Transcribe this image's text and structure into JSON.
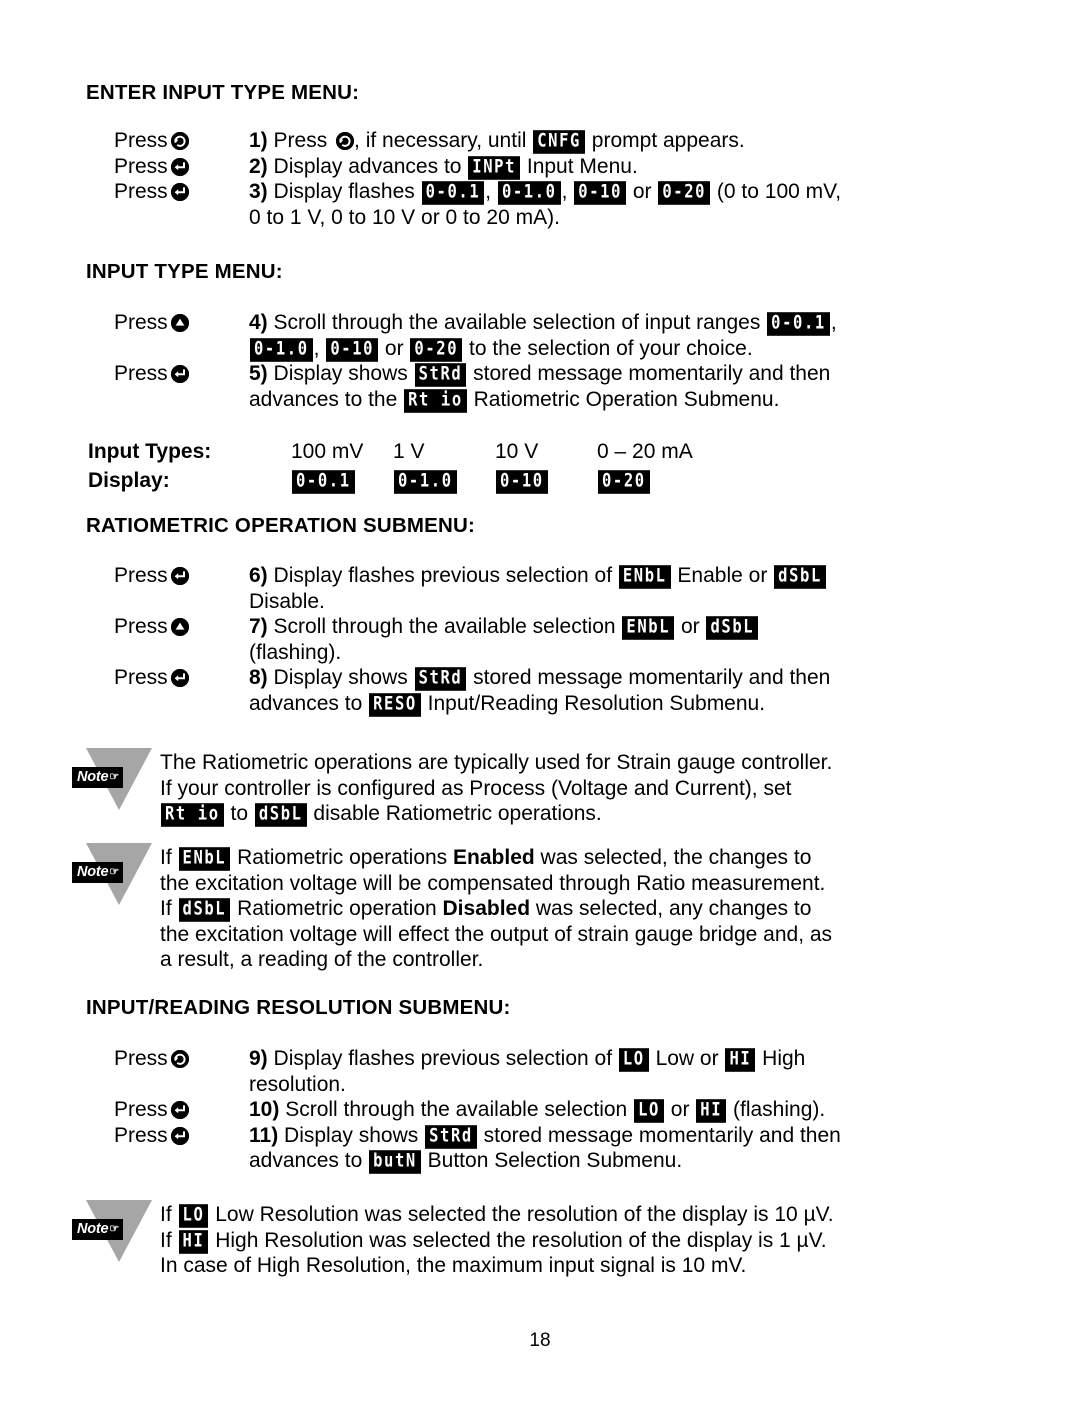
{
  "page": {
    "number": "18"
  },
  "sections": {
    "enter_input_type": {
      "heading": "ENTER INPUT TYPE MENU:",
      "press_label": "Press",
      "steps": [
        {
          "press_icon": "loop-arrow-icon",
          "number": "1)",
          "text_before": " Press ",
          "text_mid": ", if necessary, until ",
          "led": "CNFG",
          "text_after": " prompt appears."
        },
        {
          "press_icon": "enter-arrow-icon",
          "number": "2)",
          "text_before": " Display advances to ",
          "led": "INPt",
          "text_after": " Input Menu."
        },
        {
          "press_icon": "enter-arrow-icon",
          "number": "3)",
          "text_before": " Display flashes ",
          "led1": "0-0.1",
          "sep1": ", ",
          "led2": "0-1.0",
          "sep2": ", ",
          "led3": "0-10",
          "sep3": " or ",
          "led4": "0-20",
          "text_after": " (0 to 100 mV,",
          "line2": "0 to 1 V, 0 to 10 V or 0 to 20 mA)."
        }
      ]
    },
    "input_type": {
      "heading": "INPUT TYPE MENU:",
      "press_label": "Press",
      "steps": [
        {
          "press_icon": "up-triangle-icon",
          "number": "4)",
          "text_before": " Scroll through the available selection of input ranges ",
          "led1": "0-0.1",
          "sep1": ",",
          "led2": "0-1.0",
          "sep2": ", ",
          "led3": "0-10",
          "sep3": " or ",
          "led4": "0-20",
          "text_after": " to the selection of your choice."
        },
        {
          "press_icon": "enter-arrow-icon",
          "number": "5)",
          "text_before": " Display shows ",
          "led": "StRd",
          "text_mid": " stored message momentarily and then",
          "line2_before": "advances to the ",
          "led2": "Rt io",
          "line2_after": " Ratiometric Operation Submenu."
        }
      ]
    },
    "input_types_table": {
      "row_labels": [
        "Input Types:",
        "Display:"
      ],
      "types": [
        "100 mV",
        "1 V",
        "10 V",
        "0 – 20 mA"
      ],
      "displays": [
        "0-0.1",
        "0-1.0",
        "0-10",
        "0-20"
      ]
    },
    "ratiometric": {
      "heading": "RATIOMETRIC OPERATION SUBMENU:",
      "press_label": "Press",
      "steps": [
        {
          "press_icon": "enter-arrow-icon",
          "number": "6)",
          "text_before": " Display flashes previous selection of ",
          "led1": "ENbL",
          "text_mid": " Enable or ",
          "led2": "dSbL",
          "line2": "Disable."
        },
        {
          "press_icon": "up-triangle-icon",
          "number": "7)",
          "text_before": " Scroll through the available selection ",
          "led1": "ENbL",
          "text_mid": " or ",
          "led2": "dSbL",
          "line2": "(flashing)."
        },
        {
          "press_icon": "enter-arrow-icon",
          "number": "8)",
          "text_before": " Display shows ",
          "led": "StRd",
          "text_mid": " stored message momentarily and then",
          "line2_before": "advances to ",
          "led2": "RESO",
          "line2_after": " Input/Reading Resolution Submenu."
        }
      ]
    },
    "note_ratiometric": {
      "tag": "Note",
      "hand": "☞",
      "line1": "The Ratiometric operations are typically used for Strain gauge controller.",
      "line2": "If your controller is configured as Process (Voltage and Current), set",
      "line3_led1": "Rt io",
      "line3_mid": " to ",
      "line3_led2": "dSbL",
      "line3_after": " disable Ratiometric operations."
    },
    "note_enable_disable": {
      "tag": "Note",
      "hand": "☞",
      "l1_before": "If ",
      "l1_led": "ENbL",
      "l1_mid": " Ratiometric operations ",
      "l1_bold": "Enabled",
      "l1_after": " was selected, the changes to",
      "l2": "the excitation voltage will be compensated through Ratio measurement.",
      "l3_before": "If ",
      "l3_led": "dSbL",
      "l3_mid": " Ratiometric operation ",
      "l3_bold": "Disabled",
      "l3_after": " was selected, any changes to",
      "l4": "the excitation voltage will effect the output of strain gauge bridge and, as",
      "l5": "a result, a reading of the controller."
    },
    "resolution": {
      "heading": "INPUT/READING RESOLUTION SUBMENU:",
      "press_label": "Press",
      "steps": [
        {
          "press_icon": "loop-arrow-icon",
          "number": "9)",
          "text_before": " Display flashes previous selection of ",
          "led1": "LO",
          "text_mid": " Low or ",
          "led2": "HI",
          "text_after": " High",
          "line2": "resolution."
        },
        {
          "press_icon": "enter-arrow-icon",
          "number": "10)",
          "text_before": " Scroll through the available selection ",
          "led1": "LO",
          "text_mid": " or ",
          "led2": "HI",
          "text_after": " (flashing)."
        },
        {
          "press_icon": "enter-arrow-icon",
          "number": "11)",
          "text_before": " Display shows ",
          "led": "StRd",
          "text_mid": " stored message momentarily and then",
          "line2_before": "advances to ",
          "led2": "butN",
          "line2_after": " Button Selection Submenu."
        }
      ]
    },
    "note_resolution": {
      "tag": "Note",
      "hand": "☞",
      "l1_before": "If ",
      "l1_led": "LO",
      "l1_after": " Low Resolution was selected the resolution of the display is 10 µV.",
      "l2_before": "If ",
      "l2_led": "HI",
      "l2_after": " High Resolution was selected the resolution of the display is 1 µV.",
      "l3": "In case of High Resolution, the maximum input signal is 10 mV."
    }
  }
}
